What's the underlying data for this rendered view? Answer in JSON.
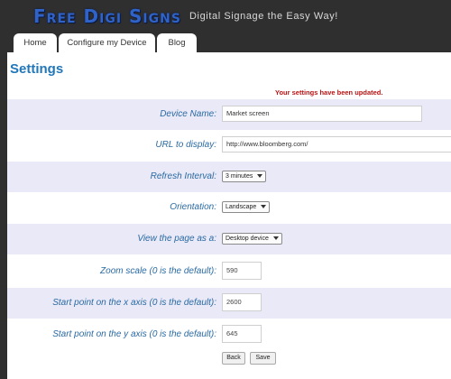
{
  "header": {
    "logo": "Free Digi Signs",
    "tagline": "Digital Signage the Easy Way!"
  },
  "nav": {
    "tabs": [
      {
        "label": "Home"
      },
      {
        "label": "Configure my Device"
      },
      {
        "label": "Blog"
      }
    ]
  },
  "page": {
    "title": "Settings",
    "status_message": "Your settings have been updated."
  },
  "form": {
    "device_name": {
      "label": "Device Name:",
      "value": "Market screen"
    },
    "url": {
      "label": "URL to display:",
      "value": "http://www.bloomberg.com/"
    },
    "refresh_interval": {
      "label": "Refresh Interval:",
      "selected": "3 minutes"
    },
    "orientation": {
      "label": "Orientation:",
      "selected": "Landscape"
    },
    "view_as": {
      "label": "View the page as a:",
      "selected": "Desktop device"
    },
    "zoom": {
      "label": "Zoom scale (0 is the default):",
      "value": "590"
    },
    "start_x": {
      "label": "Start point on the x axis (0 is the default):",
      "value": "2600"
    },
    "start_y": {
      "label": "Start point on the y axis (0 is the default):",
      "value": "645"
    }
  },
  "buttons": {
    "back": "Back",
    "save": "Save"
  }
}
